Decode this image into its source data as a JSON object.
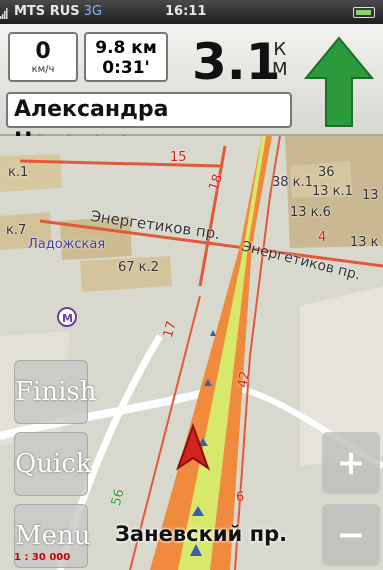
{
  "status": {
    "carrier": "MTS RUS",
    "network": "3G",
    "time": "16:11"
  },
  "nav": {
    "speed_value": "0",
    "speed_unit": "км/ч",
    "distance_next": "9.8 км",
    "time_remaining": "0:31'",
    "turn_distance": "3.1",
    "turn_unit_1": "К",
    "turn_unit_2": "М",
    "current_street": "Александра Невского",
    "next_street": "Заневский пр."
  },
  "map": {
    "metro_station": "Ладожская",
    "metro_symbol": "M",
    "street_energetikov_left": "Энергетиков пр.",
    "street_energetikov_right": "Энергетиков пр.",
    "house_labels": [
      "к.1",
      "к.7",
      "67 к.2",
      "36",
      "38 к.1",
      "13 к.1",
      "13 к.6",
      "13",
      "13 к"
    ],
    "road_numbers": [
      "15",
      "18",
      "17",
      "4",
      "42",
      "56",
      "6"
    ]
  },
  "controls": {
    "finish": "Finish",
    "quick": "Quick",
    "menu": "Menu",
    "zoom_in": "+",
    "zoom_out": "−"
  },
  "scale": "1 : 30 000",
  "colors": {
    "route": "#f08a3c",
    "route_center": "#d8e86a",
    "turn_arrow": "#2a9a3a",
    "position_arrow": "#d0241c"
  }
}
